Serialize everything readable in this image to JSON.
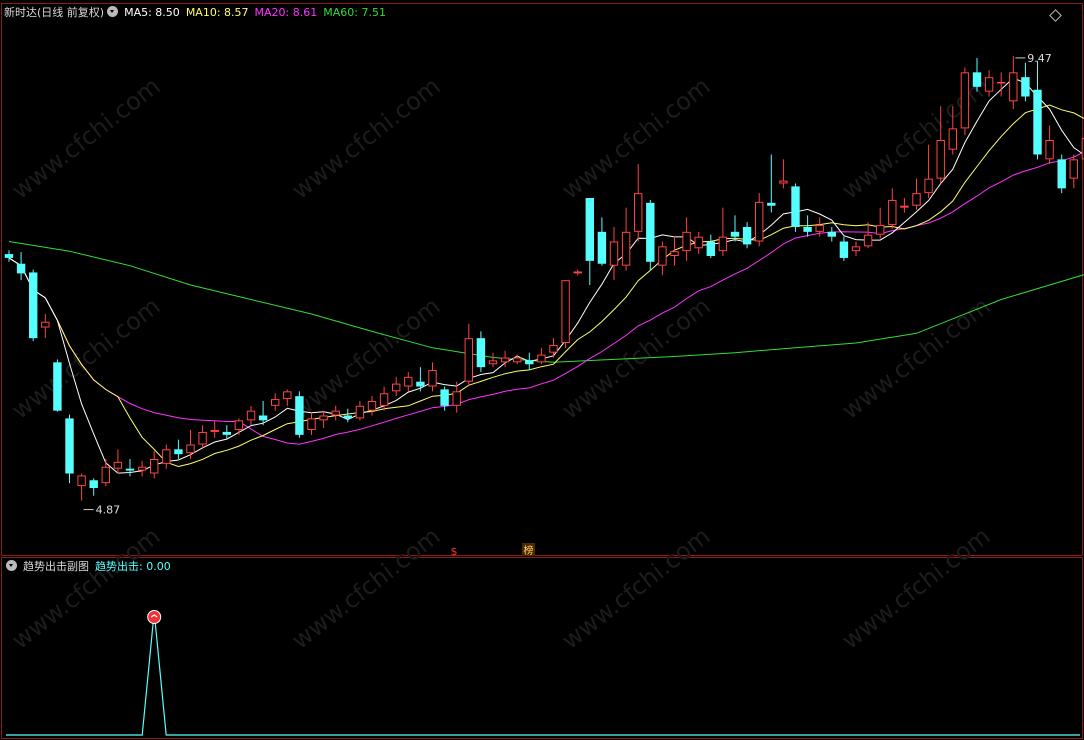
{
  "header": {
    "title": "新时达(日线 前复权)",
    "ma_items": [
      {
        "label": "MA5: 8.50",
        "color": "#ffffff"
      },
      {
        "label": "MA10: 8.57",
        "color": "#ffff66"
      },
      {
        "label": "MA20: 8.61",
        "color": "#ff33ff"
      },
      {
        "label": "MA60: 7.51",
        "color": "#33dd33"
      }
    ]
  },
  "sub_header": {
    "title": "趋势出击副图",
    "value_label": "趋势出击: 0.00",
    "value_color": "#55ffff"
  },
  "markers": {
    "s_mark": "$",
    "bang_mark": "榜"
  },
  "watermark": "www.cfchi.com",
  "chart_data": {
    "type": "candlestick",
    "price_range": [
      4.4,
      9.8
    ],
    "up_color": "#ff4444",
    "down_color": "#55ffff",
    "annotations": {
      "high": "9.47",
      "low": "4.87"
    },
    "candles": [
      [
        7.42,
        7.38,
        7.46,
        7.34
      ],
      [
        7.32,
        7.22,
        7.44,
        7.15
      ],
      [
        7.23,
        6.55,
        7.26,
        6.52
      ],
      [
        6.66,
        6.72,
        6.8,
        6.55
      ],
      [
        6.3,
        5.8,
        6.33,
        5.79
      ],
      [
        5.72,
        5.15,
        5.76,
        5.05
      ],
      [
        5.02,
        5.13,
        5.15,
        4.87
      ],
      [
        5.08,
        5.0,
        5.1,
        4.92
      ],
      [
        5.05,
        5.22,
        5.3,
        5.02
      ],
      [
        5.2,
        5.27,
        5.4,
        5.15
      ],
      [
        5.2,
        5.18,
        5.3,
        5.12
      ],
      [
        5.18,
        5.22,
        5.28,
        5.12
      ],
      [
        5.15,
        5.3,
        5.38,
        5.1
      ],
      [
        5.25,
        5.4,
        5.45,
        5.2
      ],
      [
        5.4,
        5.35,
        5.5,
        5.3
      ],
      [
        5.36,
        5.45,
        5.6,
        5.3
      ],
      [
        5.45,
        5.58,
        5.65,
        5.4
      ],
      [
        5.58,
        5.6,
        5.7,
        5.52
      ],
      [
        5.58,
        5.55,
        5.65,
        5.5
      ],
      [
        5.6,
        5.7,
        5.72,
        5.55
      ],
      [
        5.7,
        5.8,
        5.85,
        5.65
      ],
      [
        5.75,
        5.7,
        5.9,
        5.65
      ],
      [
        5.85,
        5.92,
        5.98,
        5.8
      ],
      [
        5.92,
        6.0,
        6.02,
        5.85
      ],
      [
        5.95,
        5.55,
        6.0,
        5.52
      ],
      [
        5.6,
        5.72,
        5.78,
        5.55
      ],
      [
        5.7,
        5.75,
        5.8,
        5.62
      ],
      [
        5.75,
        5.8,
        5.85,
        5.7
      ],
      [
        5.75,
        5.72,
        5.82,
        5.68
      ],
      [
        5.72,
        5.85,
        5.9,
        5.7
      ],
      [
        5.8,
        5.9,
        5.95,
        5.75
      ],
      [
        5.85,
        5.98,
        6.05,
        5.8
      ],
      [
        6.0,
        6.08,
        6.15,
        5.95
      ],
      [
        6.05,
        6.15,
        6.2,
        6.0
      ],
      [
        6.1,
        6.05,
        6.25,
        6.0
      ],
      [
        6.05,
        6.22,
        6.3,
        6.0
      ],
      [
        6.02,
        5.85,
        6.05,
        5.8
      ],
      [
        5.85,
        6.0,
        6.1,
        5.78
      ],
      [
        6.1,
        6.55,
        6.7,
        6.05
      ],
      [
        6.55,
        6.25,
        6.62,
        6.2
      ],
      [
        6.28,
        6.32,
        6.4,
        6.25
      ],
      [
        6.3,
        6.35,
        6.42,
        6.25
      ],
      [
        6.3,
        6.35,
        6.38,
        6.28
      ],
      [
        6.32,
        6.28,
        6.4,
        6.22
      ],
      [
        6.3,
        6.38,
        6.45,
        6.28
      ],
      [
        6.4,
        6.48,
        6.55,
        6.35
      ],
      [
        6.5,
        7.15,
        7.15,
        6.45
      ],
      [
        7.22,
        7.24,
        7.26,
        7.2
      ],
      [
        8.0,
        7.35,
        8.0,
        7.1
      ],
      [
        7.65,
        7.32,
        7.8,
        7.3
      ],
      [
        7.3,
        7.55,
        7.7,
        7.15
      ],
      [
        7.3,
        7.65,
        7.9,
        7.25
      ],
      [
        7.65,
        8.05,
        8.35,
        7.55
      ],
      [
        7.95,
        7.34,
        7.98,
        7.25
      ],
      [
        7.3,
        7.5,
        7.55,
        7.2
      ],
      [
        7.4,
        7.45,
        7.6,
        7.3
      ],
      [
        7.45,
        7.65,
        7.8,
        7.35
      ],
      [
        7.48,
        7.6,
        7.65,
        7.42
      ],
      [
        7.55,
        7.4,
        7.62,
        7.38
      ],
      [
        7.45,
        7.6,
        7.9,
        7.4
      ],
      [
        7.65,
        7.6,
        7.82,
        7.55
      ],
      [
        7.7,
        7.52,
        7.75,
        7.48
      ],
      [
        7.55,
        7.96,
        8.05,
        7.5
      ],
      [
        7.95,
        7.92,
        8.45,
        7.85
      ],
      [
        8.15,
        8.18,
        8.4,
        8.1
      ],
      [
        8.12,
        7.7,
        8.15,
        7.65
      ],
      [
        7.7,
        7.65,
        7.82,
        7.6
      ],
      [
        7.65,
        7.72,
        7.8,
        7.6
      ],
      [
        7.65,
        7.6,
        7.7,
        7.55
      ],
      [
        7.55,
        7.38,
        7.6,
        7.35
      ],
      [
        7.45,
        7.5,
        7.55,
        7.4
      ],
      [
        7.5,
        7.62,
        7.75,
        7.48
      ],
      [
        7.62,
        7.72,
        7.9,
        7.58
      ],
      [
        7.72,
        7.98,
        8.1,
        7.68
      ],
      [
        7.9,
        7.92,
        8.0,
        7.85
      ],
      [
        7.92,
        8.05,
        8.2,
        7.88
      ],
      [
        8.05,
        8.2,
        8.55,
        8.0
      ],
      [
        8.2,
        8.6,
        8.95,
        8.15
      ],
      [
        8.5,
        8.72,
        8.95,
        8.45
      ],
      [
        8.72,
        9.3,
        9.35,
        8.65
      ],
      [
        9.3,
        9.15,
        9.45,
        9.1
      ],
      [
        9.1,
        9.25,
        9.32,
        9.05
      ],
      [
        9.2,
        9.2,
        9.3,
        9.05
      ],
      [
        9.0,
        9.3,
        9.47,
        8.92
      ],
      [
        9.25,
        9.05,
        9.4,
        9.0
      ],
      [
        9.12,
        8.45,
        9.42,
        8.4
      ],
      [
        8.4,
        8.6,
        8.75,
        8.35
      ],
      [
        8.4,
        8.1,
        8.45,
        8.05
      ],
      [
        8.2,
        8.4,
        8.45,
        8.1
      ],
      [
        8.4,
        8.62,
        8.72,
        8.35
      ],
      [
        8.65,
        8.45,
        8.75,
        8.4
      ],
      [
        8.35,
        8.6,
        8.75,
        8.3
      ],
      [
        8.75,
        8.45,
        8.8,
        8.4
      ],
      [
        8.45,
        8.85,
        8.9,
        8.4
      ],
      [
        8.85,
        8.55,
        8.95,
        8.5
      ],
      [
        8.9,
        9.2,
        9.25,
        8.75
      ],
      [
        9.2,
        8.95,
        9.25,
        8.9
      ],
      [
        9.05,
        8.62,
        9.08,
        8.55
      ],
      [
        8.5,
        8.35,
        8.6,
        8.3
      ],
      [
        8.4,
        8.8,
        8.95,
        8.3
      ],
      [
        8.95,
        9.35,
        9.35,
        8.6
      ],
      [
        9.1,
        8.65,
        9.15,
        8.55
      ],
      [
        8.42,
        8.18,
        8.5,
        8.15
      ]
    ],
    "ma60_points": [
      [
        0,
        7.55
      ],
      [
        5,
        7.45
      ],
      [
        10,
        7.3
      ],
      [
        15,
        7.1
      ],
      [
        20,
        6.95
      ],
      [
        25,
        6.8
      ],
      [
        30,
        6.62
      ],
      [
        35,
        6.45
      ],
      [
        40,
        6.35
      ],
      [
        45,
        6.3
      ],
      [
        50,
        6.33
      ],
      [
        55,
        6.36
      ],
      [
        60,
        6.4
      ],
      [
        65,
        6.45
      ],
      [
        70,
        6.5
      ],
      [
        75,
        6.6
      ],
      [
        78,
        6.75
      ],
      [
        82,
        6.95
      ],
      [
        86,
        7.1
      ],
      [
        90,
        7.25
      ],
      [
        94,
        7.38
      ],
      [
        98,
        7.55
      ],
      [
        102,
        7.68
      ],
      [
        104,
        7.76
      ]
    ],
    "indicator": {
      "name": "趋势出击",
      "range": [
        0,
        1
      ],
      "signal_index": 12,
      "signal_value": 1
    }
  }
}
